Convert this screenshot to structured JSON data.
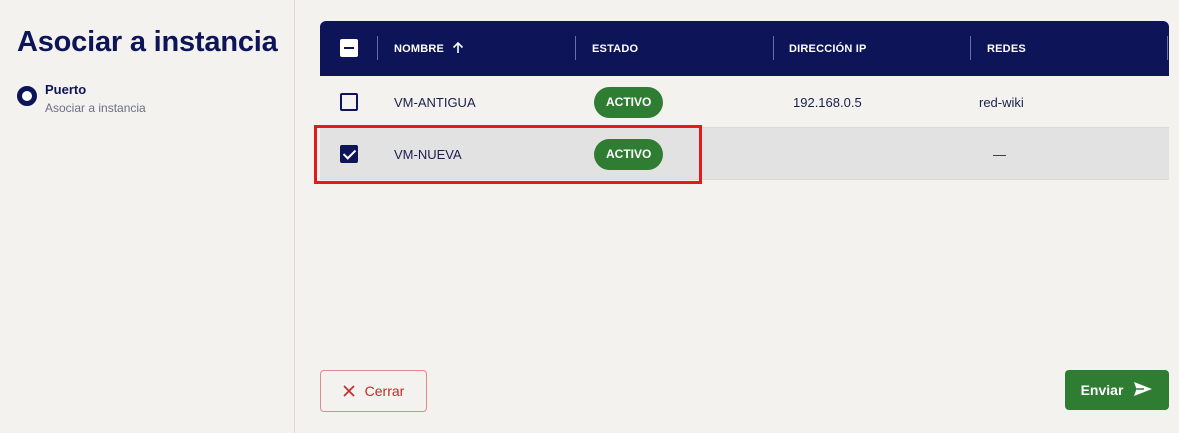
{
  "sidebar": {
    "title": "Asociar a instancia",
    "step_title": "Puerto",
    "step_subtitle": "Asociar a instancia"
  },
  "table": {
    "columns": [
      "NOMBRE",
      "ESTADO",
      "DIRECCIÓN IP",
      "REDES"
    ],
    "sort_icon": "arrow-up-icon",
    "rows": [
      {
        "name": "VM-ANTIGUA",
        "status": "ACTIVO",
        "ip": "192.168.0.5",
        "networks": "red-wiki",
        "selected": false
      },
      {
        "name": "VM-NUEVA",
        "status": "ACTIVO",
        "ip": "",
        "networks": "—",
        "selected": true
      }
    ]
  },
  "actions": {
    "close_label": "Cerrar",
    "send_label": "Enviar"
  },
  "colors": {
    "primary": "#0d1558",
    "success": "#2e7d32",
    "danger": "#c62828",
    "highlight": "#e01b1b"
  }
}
